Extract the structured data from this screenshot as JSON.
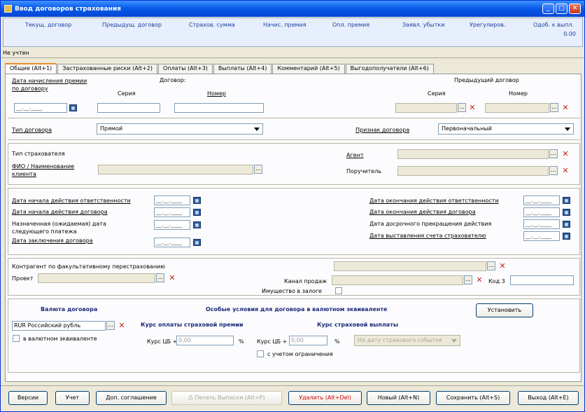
{
  "window": {
    "title": "Ввод договоров страхования",
    "min_glyph": "_",
    "max_glyph": "□",
    "close_glyph": "✕"
  },
  "info": {
    "columns": [
      "Текущ. договор",
      "Предыдущ. договор",
      "Страхов. сумма",
      "Начис. премия",
      "Опл. премия",
      "Заявл. убытки",
      "Урегулиров.",
      "Одоб. к выпл."
    ],
    "value": "0.00"
  },
  "status": "Не учтен",
  "tabs": [
    "Общие (Alt+1)",
    "Застрахованные риски (Alt+2)",
    "Оплаты (Alt+3)",
    "Выплаты (Alt+4)",
    "Комментарий (Alt+5)",
    "Выгодополучатели (Alt+6)"
  ],
  "icons": {
    "calendar": "calendar-icon",
    "ellipsis": "...",
    "clear": "✕",
    "cal_glyph": "▦"
  },
  "contract": {
    "premium_date_label": "Дата начисления премии по договору",
    "contract_label": "Договор:",
    "series_label": "Серия",
    "number_label": "Номер",
    "prev_contract_label": "Предыдущий договор",
    "prev_series_label": "Серия",
    "prev_number_label": "Номер",
    "date_placeholder": "__.__.____"
  },
  "type": {
    "label": "Тип договора",
    "value": "Прямой",
    "sign_label": "Признак договора",
    "sign_value": "Первоначальный"
  },
  "insurer": {
    "type_label": "Тип страхователя",
    "name_label": "ФИО / Наименование клиента",
    "agent_label": "Агент",
    "guarantor_label": "Поручитель"
  },
  "dates": {
    "left": [
      "Дата начала действия ответственности",
      "Дата начала действия договора",
      "Назначенная (ожидаемая) дата следующего платежа",
      "Дата заключения договора"
    ],
    "right": [
      "Дата окончания действия ответственности",
      "Дата окончания действия договора",
      "Дата досрочного прекращения действия",
      "Дата выставления счета страхователю"
    ]
  },
  "misc": {
    "counterparty_label": "Контрагент по факультативному перестрахованию",
    "project_label": "Проект",
    "channel_label": "Канал продаж",
    "code_label": "Код 3",
    "pledge_label": "Имущество в залоге"
  },
  "currency": {
    "title": "Валюта договора",
    "special_title": "Особые условия для договора в валютном эквиваленте",
    "set_button": "Установить",
    "currency_value": "RUR Российский рубль",
    "equiv_label": "в валютном эквиваленте",
    "premium_rate_title": "Курс оплаты страховой премии",
    "payout_rate_title": "Курс страховой выплаты",
    "cb_label": "Курс ЦБ +",
    "rate_placeholder": "0,00",
    "percent": "%",
    "limit_label": "с учетом ограничения",
    "date_option": "На дату страхового события"
  },
  "buttons": {
    "versions": "Версии",
    "account": "Учет",
    "addendum": "Доп. соглашение",
    "print": "Печать Выписки (Alt+P)",
    "delete": "Удалить (Alt+Del)",
    "new": "Новый (Alt+N)",
    "save": "Сохранить (Alt+S)",
    "exit": "Выход (Alt+E)"
  }
}
